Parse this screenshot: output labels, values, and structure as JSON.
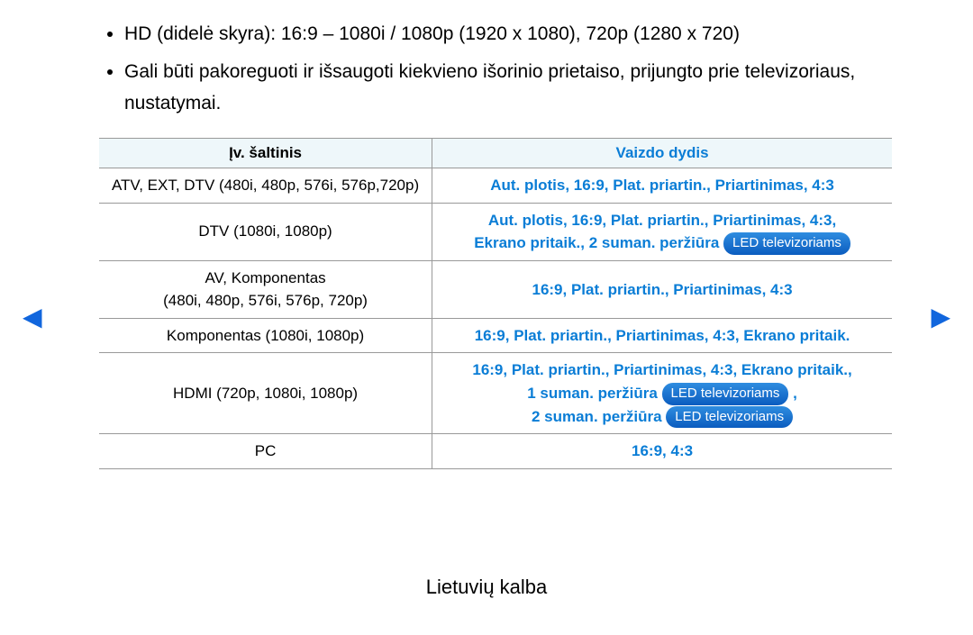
{
  "bullets": [
    "HD (didelė skyra): 16:9 – 1080i / 1080p (1920 x 1080), 720p (1280 x 720)",
    "Gali būti pakoreguoti ir išsaugoti kiekvieno išorinio prietaiso, prijungto prie televizoriaus, nustatymai."
  ],
  "headers": {
    "source": "Įv. šaltinis",
    "size": "Vaizdo dydis"
  },
  "rows": {
    "r0c0": "ATV, EXT, DTV (480i, 480p, 576i, 576p,720p)",
    "r0c1": "Aut. plotis, 16:9, Plat. priartin., Priartinimas, 4:3",
    "r1c0": "DTV (1080i, 1080p)",
    "r1c1a": "Aut. plotis, 16:9, Plat. priartin., Priartinimas, 4:3,",
    "r1c1b": "Ekrano pritaik., 2 suman. peržiūra ",
    "r2c0a": "AV, Komponentas",
    "r2c0b": "(480i, 480p, 576i, 576p, 720p)",
    "r2c1": "16:9, Plat. priartin., Priartinimas, 4:3",
    "r3c0": "Komponentas (1080i, 1080p)",
    "r3c1": "16:9, Plat. priartin., Priartinimas, 4:3, Ekrano pritaik.",
    "r4c0": "HDMI (720p, 1080i, 1080p)",
    "r4c1a": "16:9, Plat. priartin., Priartinimas, 4:3, Ekrano pritaik.,",
    "r4c1b": "1 suman. peržiūra ",
    "r4c1c": "2 suman. peržiūra ",
    "r5c0": "PC",
    "r5c1": "16:9, 4:3"
  },
  "badge": "LED televizoriams",
  "comma": " ,",
  "footer": "Lietuvių kalba",
  "nav": {
    "left": "◀",
    "right": "▶"
  }
}
